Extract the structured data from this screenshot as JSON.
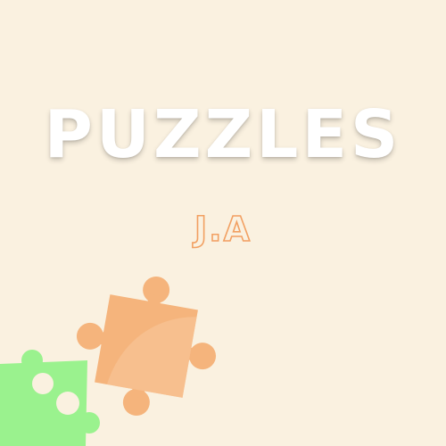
{
  "title": "PUZZLES",
  "subtitle": "J.A",
  "colors": {
    "background": "#FAF1E0",
    "title": "#FFFFFF",
    "subtitle_outline": "#F2A062",
    "orange_piece": "#F5B47C",
    "orange_piece_highlight": "#F8C598",
    "green_piece": "#9AF28E"
  },
  "icons": [
    "orange-puzzle-piece-icon",
    "green-puzzle-piece-icon"
  ]
}
